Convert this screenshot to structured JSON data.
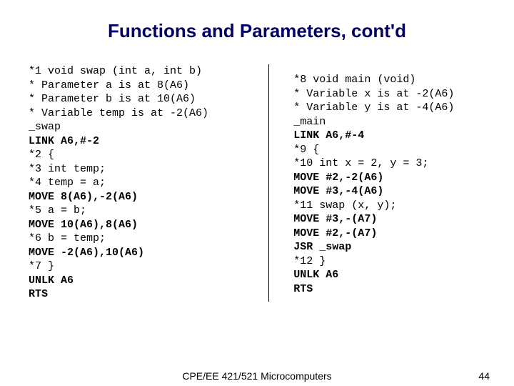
{
  "title": "Functions and Parameters, cont'd",
  "left_lines": [
    {
      "t": "*1 void swap (int a, int b)",
      "b": false
    },
    {
      "t": "* Parameter a is at 8(A6)",
      "b": false
    },
    {
      "t": "* Parameter b is at 10(A6)",
      "b": false
    },
    {
      "t": "* Variable temp is at -2(A6)",
      "b": false
    },
    {
      "t": "_swap",
      "b": false
    },
    {
      "t": "LINK A6,#-2",
      "b": true
    },
    {
      "t": "*2 {",
      "b": false
    },
    {
      "t": "*3 int temp;",
      "b": false
    },
    {
      "t": "*4 temp = a;",
      "b": false
    },
    {
      "t": "MOVE 8(A6),-2(A6)",
      "b": true
    },
    {
      "t": "*5 a = b;",
      "b": false
    },
    {
      "t": "MOVE 10(A6),8(A6)",
      "b": true
    },
    {
      "t": "*6 b = temp;",
      "b": false
    },
    {
      "t": "MOVE -2(A6),10(A6)",
      "b": true
    },
    {
      "t": "*7 }",
      "b": false
    },
    {
      "t": "UNLK A6",
      "b": true
    },
    {
      "t": "RTS",
      "b": true
    }
  ],
  "right_lines": [
    {
      "t": "*8 void main (void)",
      "b": false
    },
    {
      "t": "* Variable x is at -2(A6)",
      "b": false
    },
    {
      "t": "* Variable y is at -4(A6)",
      "b": false
    },
    {
      "t": "_main",
      "b": false
    },
    {
      "t": "LINK A6,#-4",
      "b": true
    },
    {
      "t": "*9 {",
      "b": false
    },
    {
      "t": "*10 int x = 2, y = 3;",
      "b": false
    },
    {
      "t": "MOVE #2,-2(A6)",
      "b": true
    },
    {
      "t": "MOVE #3,-4(A6)",
      "b": true
    },
    {
      "t": "*11 swap (x, y);",
      "b": false
    },
    {
      "t": "MOVE #3,-(A7)",
      "b": true
    },
    {
      "t": "MOVE #2,-(A7)",
      "b": true
    },
    {
      "t": "JSR _swap",
      "b": true
    },
    {
      "t": "*12 }",
      "b": false
    },
    {
      "t": "UNLK A6",
      "b": true
    },
    {
      "t": "RTS",
      "b": true
    }
  ],
  "footer_center": "CPE/EE 421/521 Microcomputers",
  "footer_right": "44"
}
